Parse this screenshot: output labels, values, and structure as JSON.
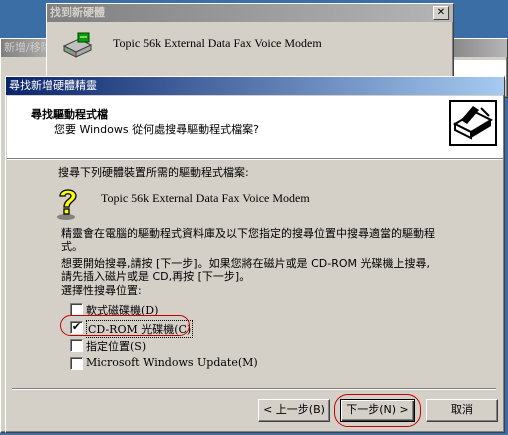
{
  "colors": {
    "desktop": "#3a6ea5",
    "active_title": "#0a246a",
    "highlight_ring": "#c00000"
  },
  "found_hw_window": {
    "title": "找到新硬體",
    "device_name": "Topic 56k External Data Fax Voice Modem",
    "close_symbol": "✕",
    "icon": "modem-icon"
  },
  "bg_window": {
    "title": "新增/移除"
  },
  "wizard": {
    "title": "尋找新增硬體精靈",
    "header_title": "尋找驅動程式檔",
    "header_subtitle": "您要 Windows 從何處搜尋驅動程式檔案?",
    "header_icon": "hardware-wizard-icon",
    "search_intro": "搜尋下列硬體裝置所需的驅動程式檔案:",
    "device_name": "Topic 56k External Data Fax Voice Modem",
    "device_icon": "question-icon",
    "para1_line1": "精靈會在電腦的驅動程式資料庫及以下您指定的搜尋位置中搜尋適當的驅動程",
    "para1_line2": "式。",
    "para2_line1": "想要開始搜尋,請按 [下一步]。如果您將在磁片或是 CD-ROM 光碟機上搜尋,",
    "para2_line2": "請先插入磁片或是 CD,再按 [下一步]。",
    "optional_label": "選擇性搜尋位置:",
    "options": [
      {
        "label": "軟式磁碟機(D)",
        "checked": false
      },
      {
        "label": "CD-ROM 光碟機(C)",
        "checked": true
      },
      {
        "label": "指定位置(S)",
        "checked": false
      },
      {
        "label": "Microsoft Windows Update(M)",
        "checked": false
      }
    ],
    "check_mark": "✔",
    "buttons": {
      "back": "< 上一步(B)",
      "next": "下一步(N) >",
      "cancel": "取消"
    }
  }
}
